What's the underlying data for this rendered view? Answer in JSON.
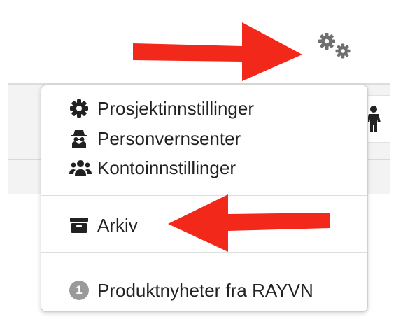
{
  "menu": {
    "items": [
      {
        "label": "Prosjektinnstillinger",
        "icon": "gear-icon"
      },
      {
        "label": "Personvernsenter",
        "icon": "spy-icon"
      },
      {
        "label": "Kontoinnstillinger",
        "icon": "users-icon"
      },
      {
        "label": "Arkiv",
        "icon": "archive-icon"
      },
      {
        "label": "Produktnyheter fra RAYVN",
        "icon": "badge-icon",
        "badge": "1"
      }
    ]
  },
  "toolbar": {
    "settings_icon": "gears-icon",
    "person_icon": "person-icon"
  },
  "colors": {
    "annotation_arrow": "#f2281b",
    "icon_dark": "#222222",
    "icon_grey": "#6f6f6f",
    "badge": "#9a9a9a"
  }
}
